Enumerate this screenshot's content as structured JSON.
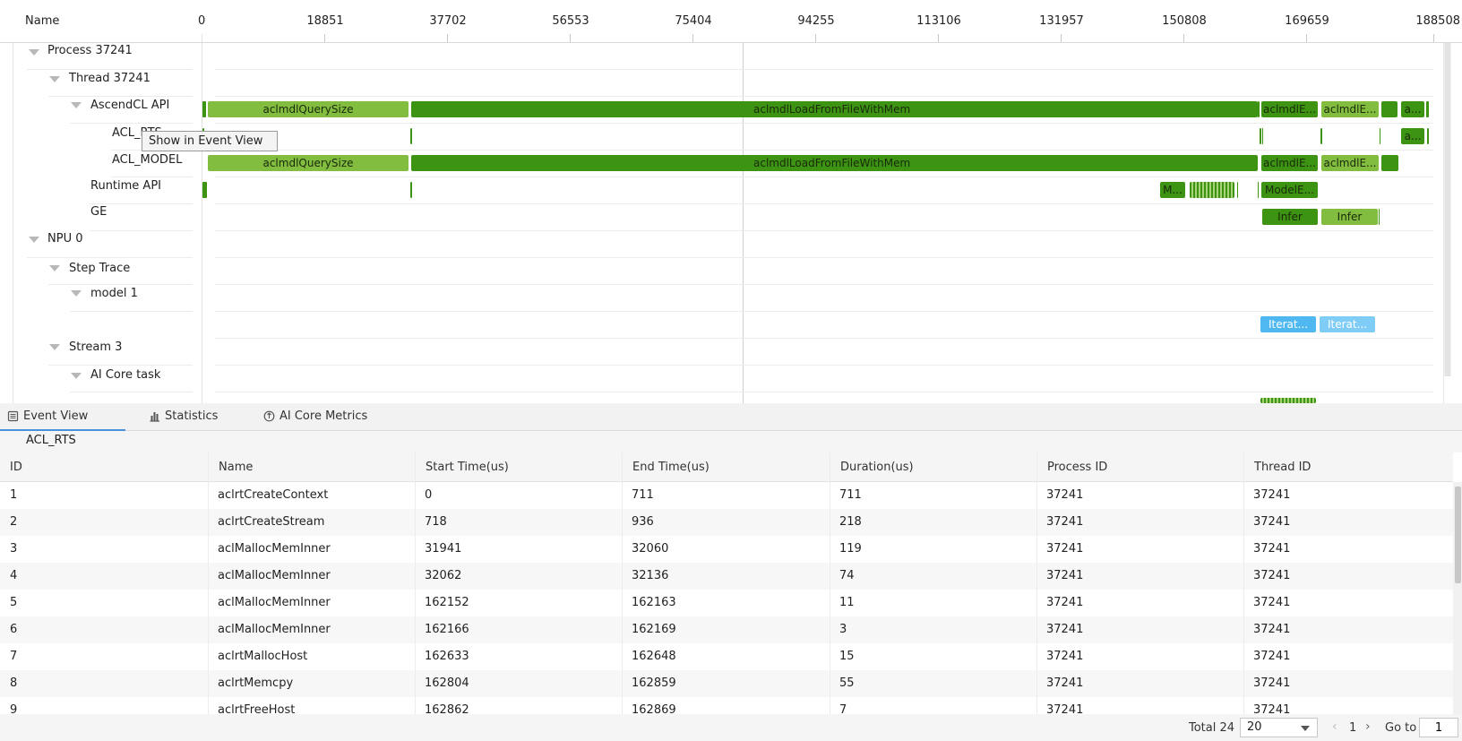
{
  "timeline": {
    "name_header": "Name",
    "ticks": [
      "0",
      "18851",
      "37702",
      "56553",
      "75404",
      "94255",
      "113106",
      "131957",
      "150808",
      "169659",
      "188508"
    ],
    "rows": {
      "process": "Process 37241",
      "thread": "Thread 37241",
      "ascendcl": "AscendCL API",
      "acl_rts": "ACL_RTS",
      "acl_model": "ACL_MODEL",
      "runtime": "Runtime API",
      "ge": "GE",
      "npu": "NPU 0",
      "step_trace": "Step Trace",
      "model1": "model 1",
      "stream3": "Stream 3",
      "aicore": "AI Core task"
    },
    "bars": {
      "query_size": "aclmdlQuerySize",
      "load_file": "aclmdlLoadFromFileWithMem",
      "exec1": "aclmdlE...",
      "exec2": "aclmdlE...",
      "a1": "a...",
      "a2": "a...",
      "model_query": "aclmdlQuerySize",
      "model_load": "aclmdlLoadFromFileWithMem",
      "model_exec1": "aclmdlE...",
      "model_exec2": "aclmdlE...",
      "rt_m": "M...",
      "rt_model": "ModelE...",
      "infer1": "Infer",
      "infer2": "Infer",
      "iter1": "Iterat...",
      "iter2": "Iterat..."
    },
    "tooltip": "Show in Event View"
  },
  "tabs": [
    {
      "label": "Event View",
      "icon": "list-icon"
    },
    {
      "label": "Statistics",
      "icon": "bar-chart-icon"
    },
    {
      "label": "AI Core Metrics",
      "icon": "chip-icon"
    }
  ],
  "section_title": "ACL_RTS",
  "table": {
    "columns": [
      "ID",
      "Name",
      "Start Time(us)",
      "End Time(us)",
      "Duration(us)",
      "Process ID",
      "Thread ID"
    ],
    "rows": [
      [
        "1",
        "aclrtCreateContext",
        "0",
        "711",
        "711",
        "37241",
        "37241"
      ],
      [
        "2",
        "aclrtCreateStream",
        "718",
        "936",
        "218",
        "37241",
        "37241"
      ],
      [
        "3",
        "aclMallocMemInner",
        "31941",
        "32060",
        "119",
        "37241",
        "37241"
      ],
      [
        "4",
        "aclMallocMemInner",
        "32062",
        "32136",
        "74",
        "37241",
        "37241"
      ],
      [
        "5",
        "aclMallocMemInner",
        "162152",
        "162163",
        "11",
        "37241",
        "37241"
      ],
      [
        "6",
        "aclMallocMemInner",
        "162166",
        "162169",
        "3",
        "37241",
        "37241"
      ],
      [
        "7",
        "aclrtMallocHost",
        "162633",
        "162648",
        "15",
        "37241",
        "37241"
      ],
      [
        "8",
        "aclrtMemcpy",
        "162804",
        "162859",
        "55",
        "37241",
        "37241"
      ],
      [
        "9",
        "aclrtFreeHost",
        "162862",
        "162869",
        "7",
        "37241",
        "37241"
      ]
    ]
  },
  "pager": {
    "total": "Total 24",
    "page_size": "20",
    "page": "1",
    "goto_label": "Go to",
    "goto_value": "1",
    "prev": "‹",
    "next": "›"
  }
}
